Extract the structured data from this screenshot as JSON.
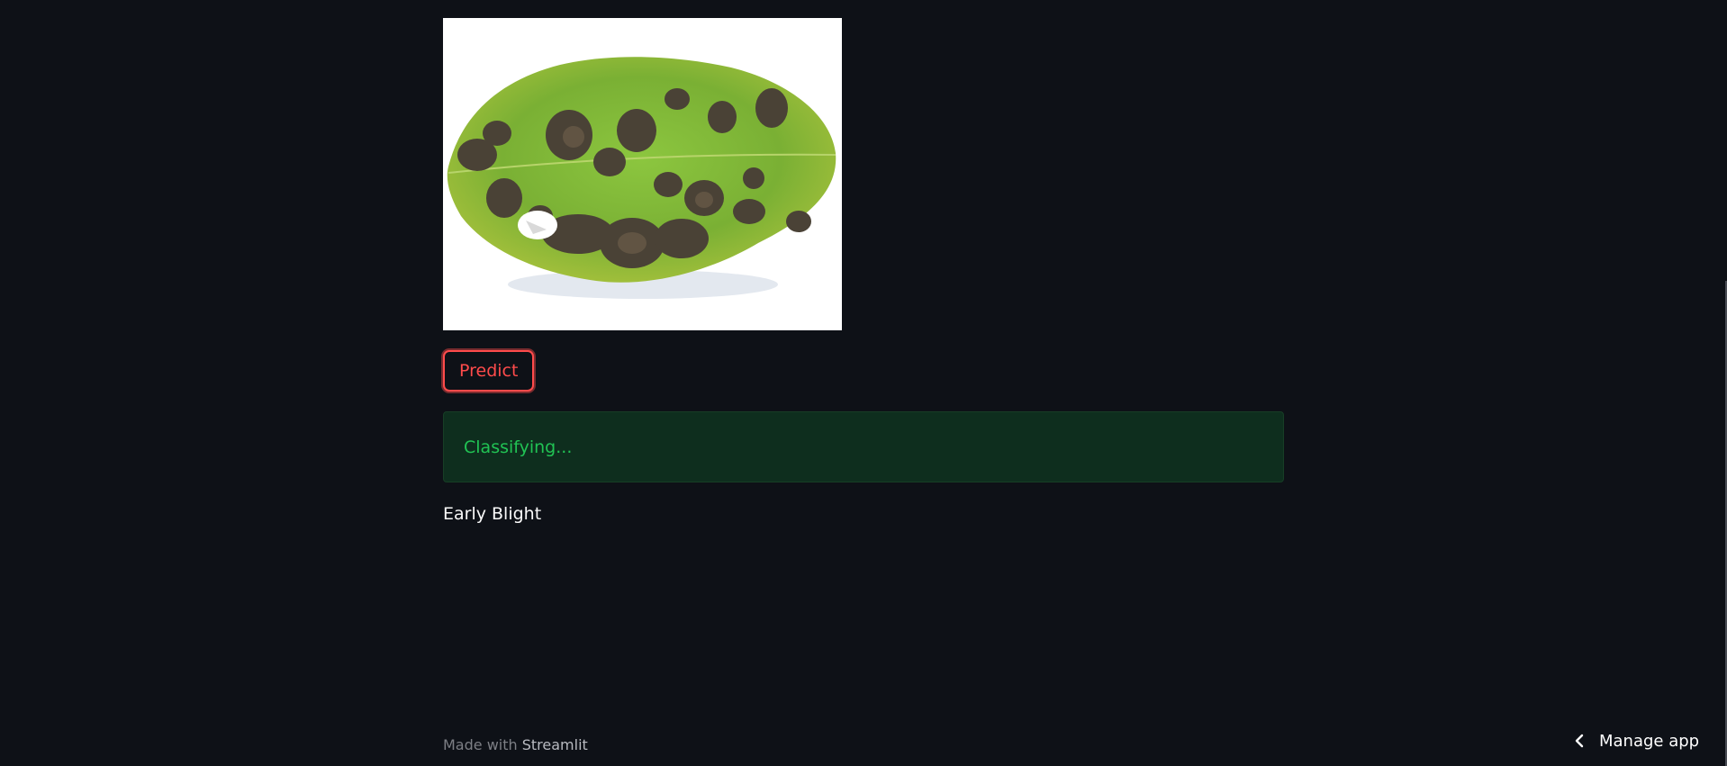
{
  "main": {
    "image": {
      "icon": "leaf-image"
    },
    "predict_button": {
      "label": "Predict",
      "color": "#ff4b4b"
    },
    "status": {
      "text": "Classifying...",
      "color": "#21c354"
    },
    "result": {
      "text": "Early Blight"
    }
  },
  "footer": {
    "prefix": "Made with ",
    "brand": "Streamlit"
  },
  "manage_app": {
    "icon": "chevron-left-icon",
    "label": "Manage app"
  },
  "colors": {
    "background": "#0e1117",
    "alert_background": "#0e2e1e",
    "text": "#fafafa"
  }
}
